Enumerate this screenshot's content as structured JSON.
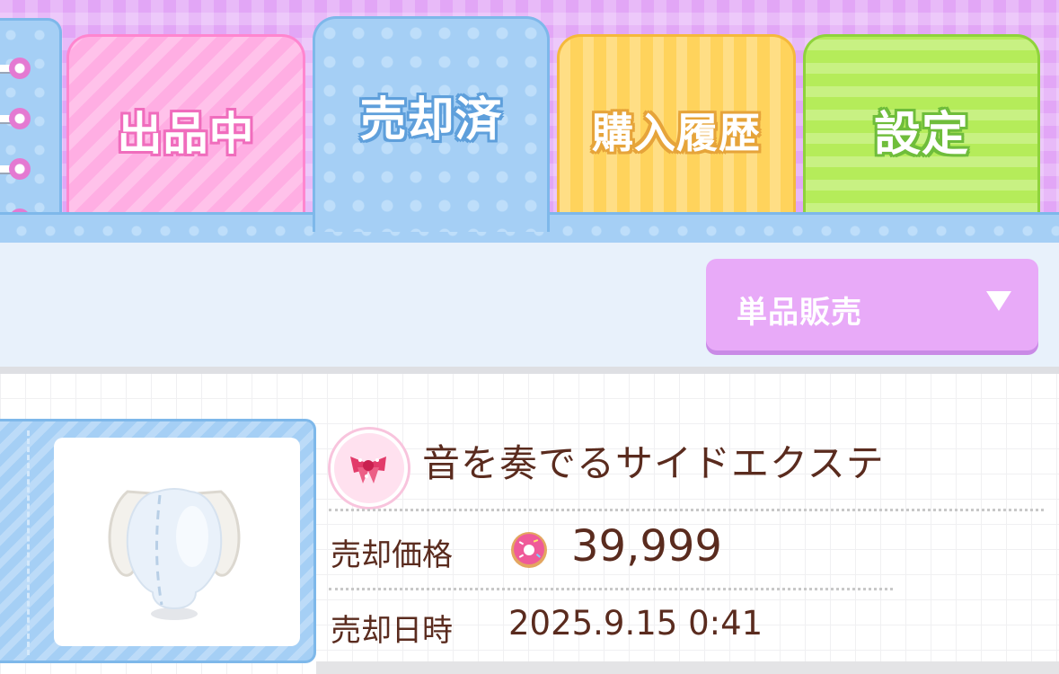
{
  "tabs": [
    {
      "label": "出品中",
      "selected": false
    },
    {
      "label": "売却済",
      "selected": true
    },
    {
      "label": "購入履歴",
      "selected": false
    },
    {
      "label": "設定",
      "selected": false
    }
  ],
  "filter": {
    "selected": "単品販売"
  },
  "item": {
    "name": "音を奏でるサイドエクステ",
    "price_label": "売却価格",
    "price_value": "39,999",
    "currency_icon": "donut-icon",
    "date_label": "売却日時",
    "date_value": "2025.9.15 0:41"
  },
  "colors": {
    "header_bg": "#e2a6f6",
    "tab_listing": "#ffaee3",
    "tab_sold": "#a5cff5",
    "tab_history": "#ffd35c",
    "tab_settings": "#b5ec5a",
    "dropdown": "#e8aaf8",
    "text_brown": "#5a2b1e"
  }
}
